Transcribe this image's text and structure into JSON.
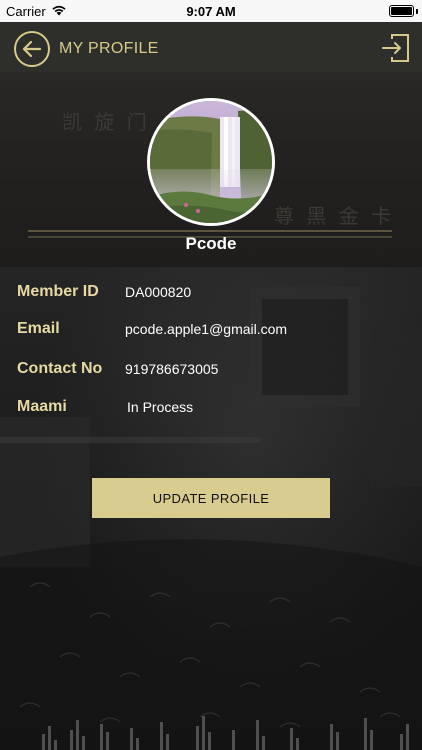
{
  "status_bar": {
    "carrier": "Carrier",
    "time": "9:07 AM",
    "icons": [
      "wifi-icon",
      "battery-icon"
    ]
  },
  "nav": {
    "title": "MY PROFILE",
    "back_icon": "back-arrow-icon",
    "logout_icon": "logout-icon"
  },
  "profile": {
    "name": "Pcode",
    "fields": [
      {
        "label": "Member ID",
        "value": "DA000820"
      },
      {
        "label": "Email",
        "value": "pcode.apple1@gmail.com"
      },
      {
        "label": "Contact No",
        "value": "919786673005"
      },
      {
        "label": "Maami",
        "value": "In Process"
      }
    ]
  },
  "actions": {
    "update_label": "UPDATE PROFILE"
  },
  "colors": {
    "accent_gold": "#d8c98a",
    "label_gold": "#e6d9a3",
    "button_gold": "#d8cc8e",
    "nav_bg": "#2e2e2b",
    "bg_dark": "#1b1b1b"
  }
}
